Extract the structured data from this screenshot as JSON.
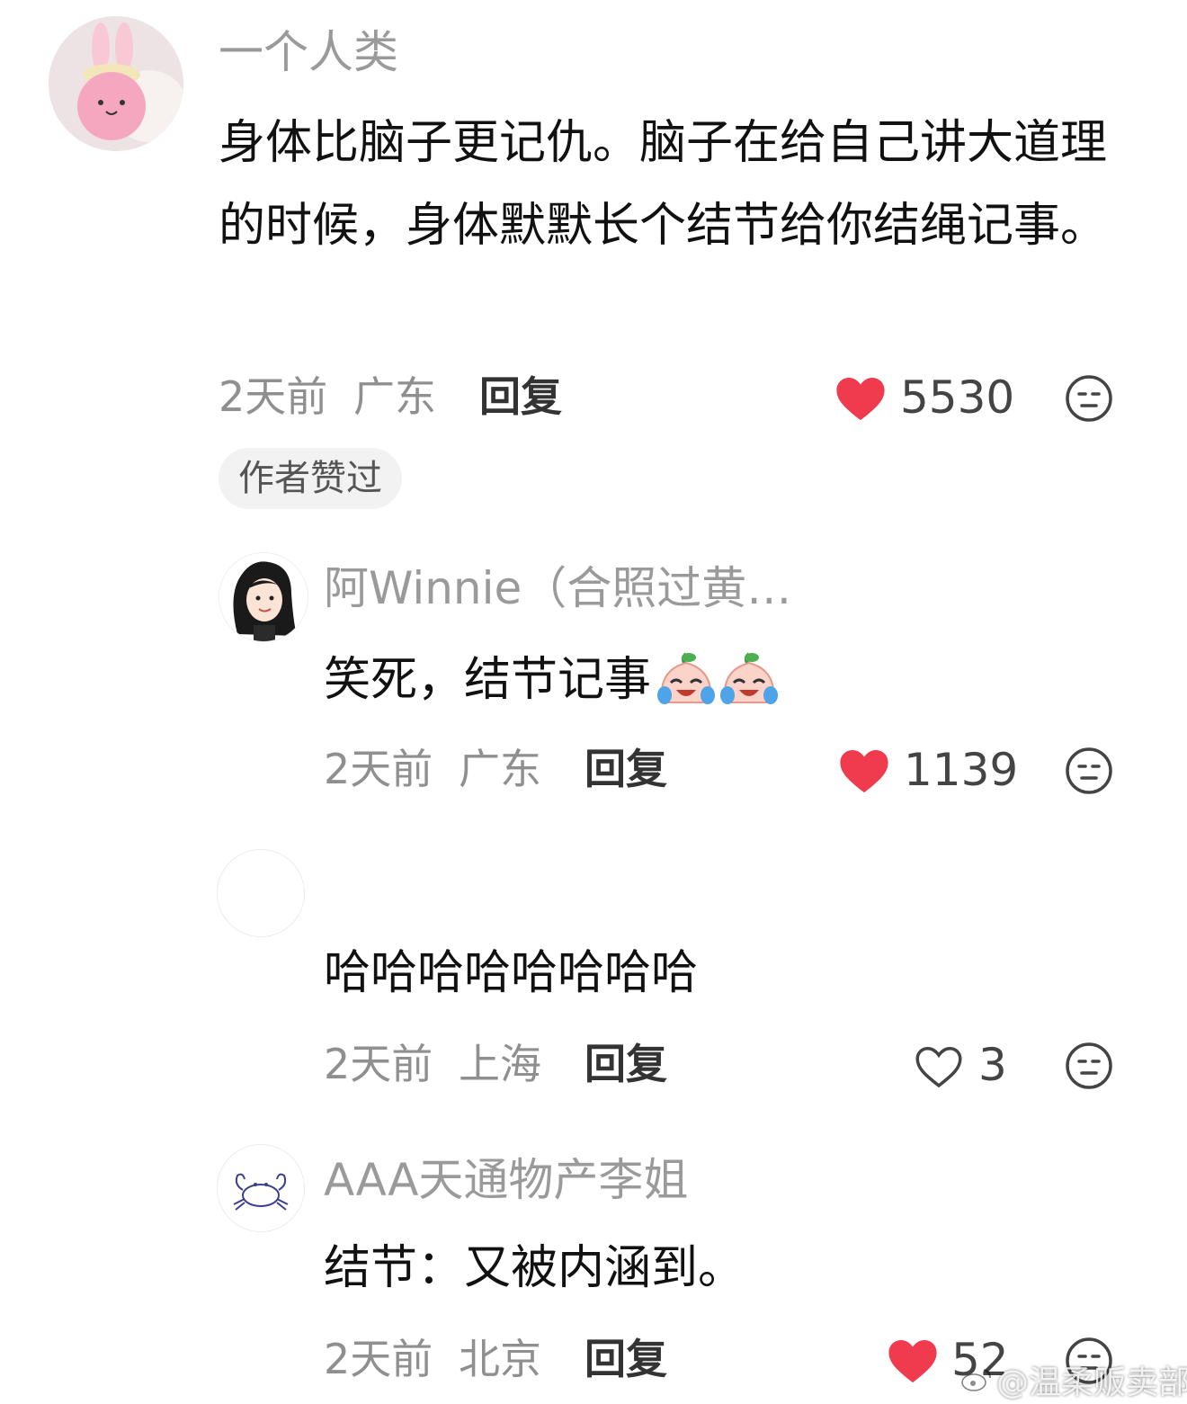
{
  "colors": {
    "like_active": "#f03a4d",
    "meta_gray": "#8f8f8f",
    "username_gray": "#9a9a9a",
    "text": "#111111"
  },
  "comments": [
    {
      "username": "一个人类",
      "text": "身体比脑子更记仇。脑子在给自己讲大道理的时候，身体默默长个结节给你结绳记事。",
      "time": "2天前",
      "location": "广东",
      "reply_label": "回复",
      "likes": "5530",
      "liked": true,
      "badge": "作者赞过",
      "avatar_icon": "pink-bunny-avatar"
    },
    {
      "username": "阿Winnie（合照过黄…",
      "text": "笑死，结节记事",
      "emoji_icon": "crying-laughing-emoji",
      "time": "2天前",
      "location": "广东",
      "reply_label": "回复",
      "likes": "1139",
      "liked": true,
      "avatar_icon": "cartoon-girl-avatar"
    },
    {
      "username": "",
      "text": "哈哈哈哈哈哈哈哈",
      "time": "2天前",
      "location": "上海",
      "reply_label": "回复",
      "likes": "3",
      "liked": false,
      "avatar_icon": "blank-avatar"
    },
    {
      "username": "AAA天通物产李姐",
      "text": "结节：又被内涵到。",
      "time": "2天前",
      "location": "北京",
      "reply_label": "回复",
      "likes": "52",
      "liked": true,
      "avatar_icon": "crab-avatar"
    }
  ],
  "watermark": "@温柔贩卖部"
}
